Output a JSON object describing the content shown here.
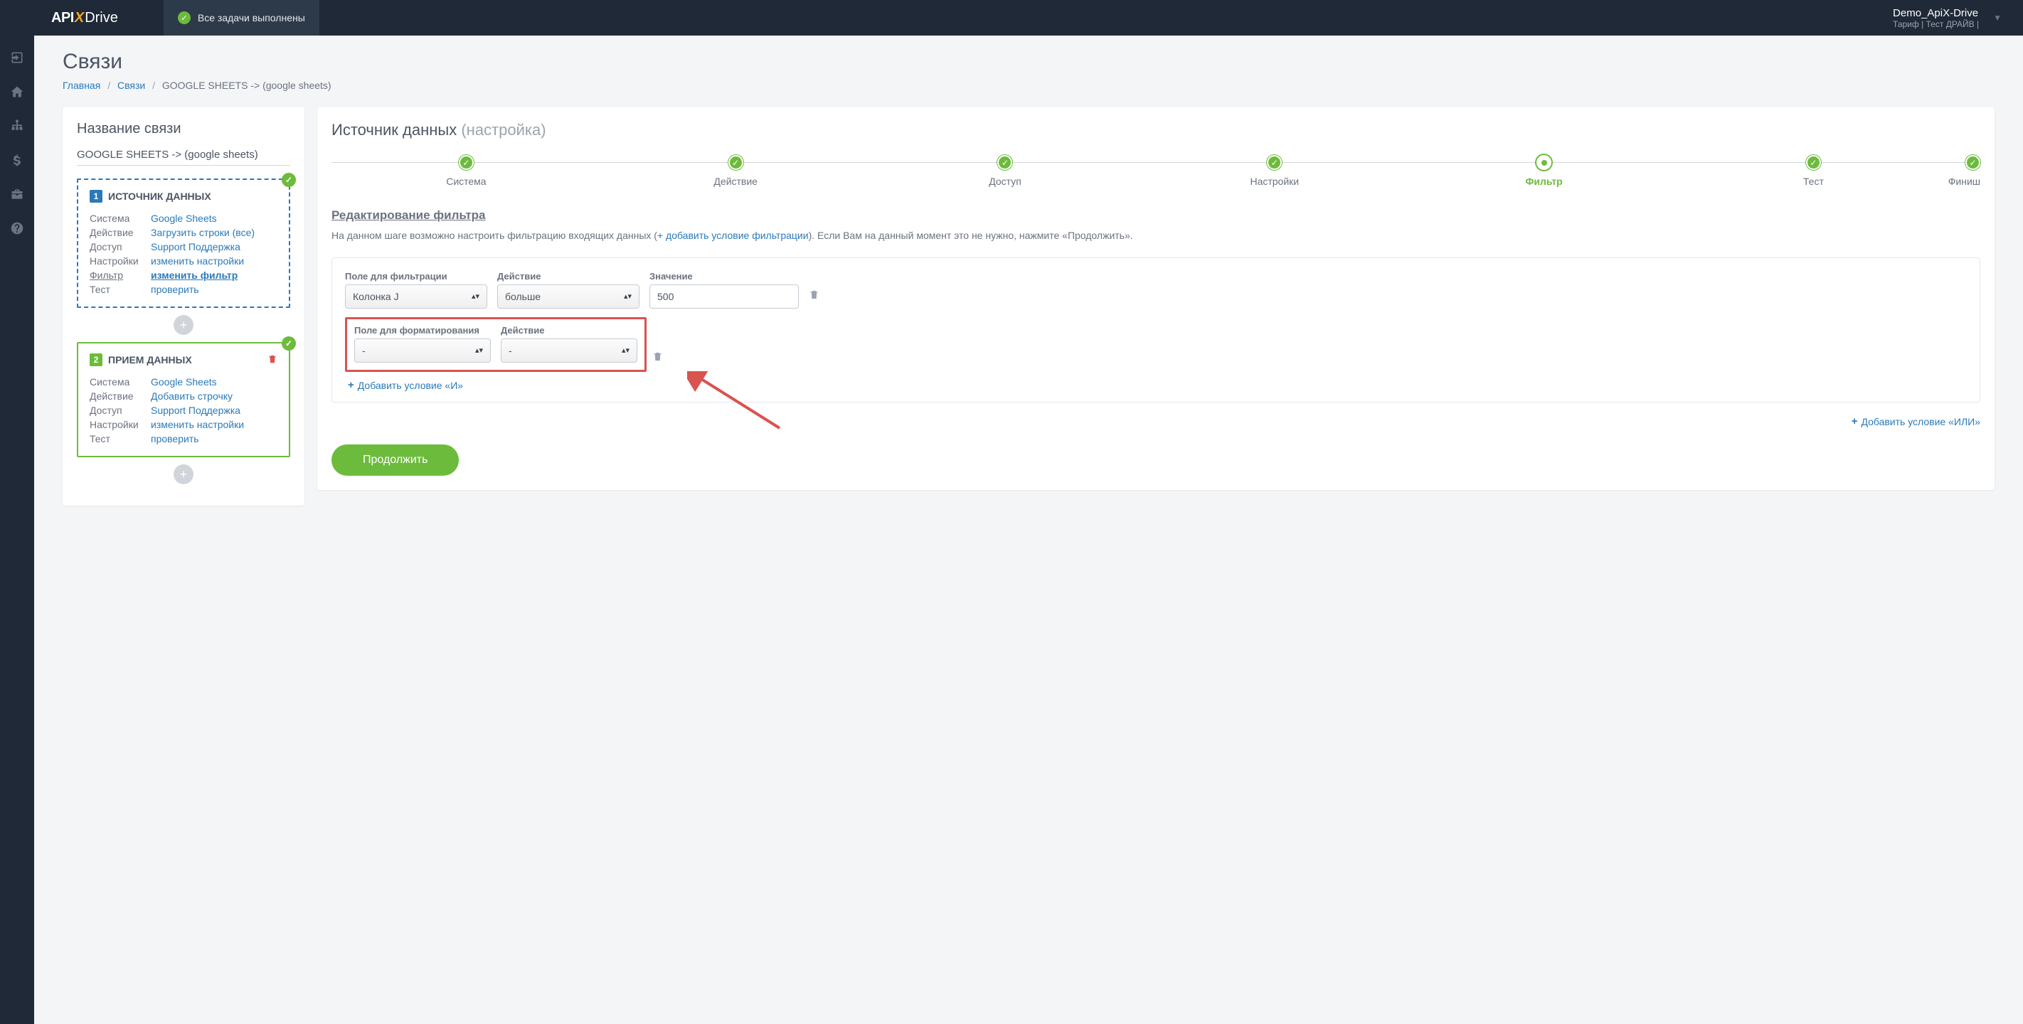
{
  "header": {
    "logo_api": "API",
    "logo_x": "X",
    "logo_drive": "Drive",
    "tasks_done": "Все задачи выполнены",
    "user_name": "Demo_ApiX-Drive",
    "user_tariff": "Тариф | Тест ДРАЙВ |"
  },
  "page": {
    "title": "Связи",
    "breadcrumb_home": "Главная",
    "breadcrumb_links": "Связи",
    "breadcrumb_current": "GOOGLE SHEETS -> (google sheets)"
  },
  "left_panel": {
    "heading": "Название связи",
    "name_value": "GOOGLE SHEETS -> (google sheets)",
    "source_title": "ИСТОЧНИК ДАННЫХ",
    "receiver_title": "ПРИЕМ ДАННЫХ",
    "labels": {
      "system": "Система",
      "action": "Действие",
      "access": "Доступ",
      "settings": "Настройки",
      "filter": "Фильтр",
      "test": "Тест"
    },
    "source": {
      "system": "Google Sheets",
      "action": "Загрузить строки (все)",
      "access": "Support Поддержка",
      "settings": "изменить настройки",
      "filter": "изменить фильтр",
      "test": "проверить"
    },
    "receiver": {
      "system": "Google Sheets",
      "action": "Добавить строчку",
      "access": "Support Поддержка",
      "settings": "изменить настройки",
      "test": "проверить"
    }
  },
  "right_panel": {
    "heading": "Источник данных",
    "heading_sub": "(настройка)",
    "steps": {
      "system": "Система",
      "action": "Действие",
      "access": "Доступ",
      "settings": "Настройки",
      "filter": "Фильтр",
      "test": "Тест",
      "finish": "Финиш"
    },
    "section_title": "Редактирование фильтра",
    "section_desc_1": "На данном шаге возможно настроить фильтрацию входящих данных (",
    "section_desc_link": "+ добавить условие фильтрации",
    "section_desc_2": "). Если Вам на данный момент это не нужно, нажмите «Продолжить».",
    "filter": {
      "field_label": "Поле для фильтрации",
      "action_label": "Действие",
      "value_label": "Значение",
      "format_field_label": "Поле для форматирования",
      "field_value": "Колонка J",
      "action_value": "больше",
      "value_value": "500",
      "format_field_value": "-",
      "format_action_value": "-",
      "add_and": "Добавить условие «И»",
      "add_or": "Добавить условие «ИЛИ»"
    },
    "continue": "Продолжить"
  }
}
